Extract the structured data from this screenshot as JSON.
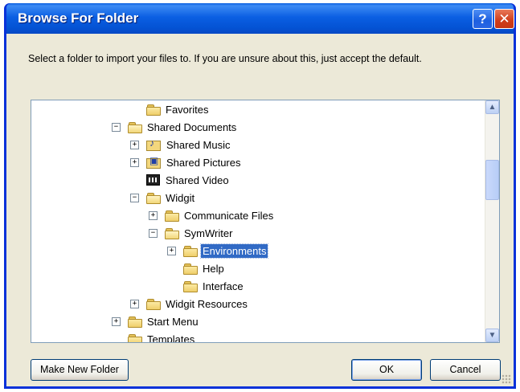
{
  "window": {
    "title": "Browse For Folder",
    "help_icon": "?",
    "close_icon": "✕"
  },
  "instruction": "Select a folder to import your files to. If you are unsure about this, just accept the default.",
  "tree": {
    "items": [
      {
        "label": "Favorites",
        "expander": "",
        "icon": "folder-icon",
        "level": 1
      },
      {
        "label": "Shared Documents",
        "expander": "−",
        "icon": "folder-open-icon",
        "level": 0
      },
      {
        "label": "Shared Music",
        "expander": "+",
        "icon": "music-folder-icon",
        "level": 1
      },
      {
        "label": "Shared Pictures",
        "expander": "+",
        "icon": "pictures-folder-icon",
        "level": 1
      },
      {
        "label": "Shared Video",
        "expander": "",
        "icon": "video-folder-icon",
        "level": 1
      },
      {
        "label": "Widgit",
        "expander": "−",
        "icon": "folder-open-icon",
        "level": 1
      },
      {
        "label": "Communicate Files",
        "expander": "+",
        "icon": "folder-icon",
        "level": 2
      },
      {
        "label": "SymWriter",
        "expander": "−",
        "icon": "folder-open-icon",
        "level": 2
      },
      {
        "label": "Environments",
        "expander": "+",
        "icon": "folder-icon",
        "level": 3,
        "selected": true
      },
      {
        "label": "Help",
        "expander": "",
        "icon": "folder-icon",
        "level": 3
      },
      {
        "label": "Interface",
        "expander": "",
        "icon": "folder-icon",
        "level": 3
      },
      {
        "label": "Widgit Resources",
        "expander": "+",
        "icon": "folder-icon",
        "level": 1
      },
      {
        "label": "Start Menu",
        "expander": "+",
        "icon": "folder-icon",
        "level": 0
      },
      {
        "label": "Templates",
        "expander": "",
        "icon": "folder-icon",
        "level": 0
      }
    ],
    "scroll_up_icon": "▲",
    "scroll_down_icon": "▼"
  },
  "buttons": {
    "make_new_folder": "Make New Folder",
    "ok": "OK",
    "cancel": "Cancel"
  },
  "colors": {
    "selection": "#316ac5",
    "titlebar": "#0b5fe3",
    "dialog_bg": "#ece9d8"
  }
}
